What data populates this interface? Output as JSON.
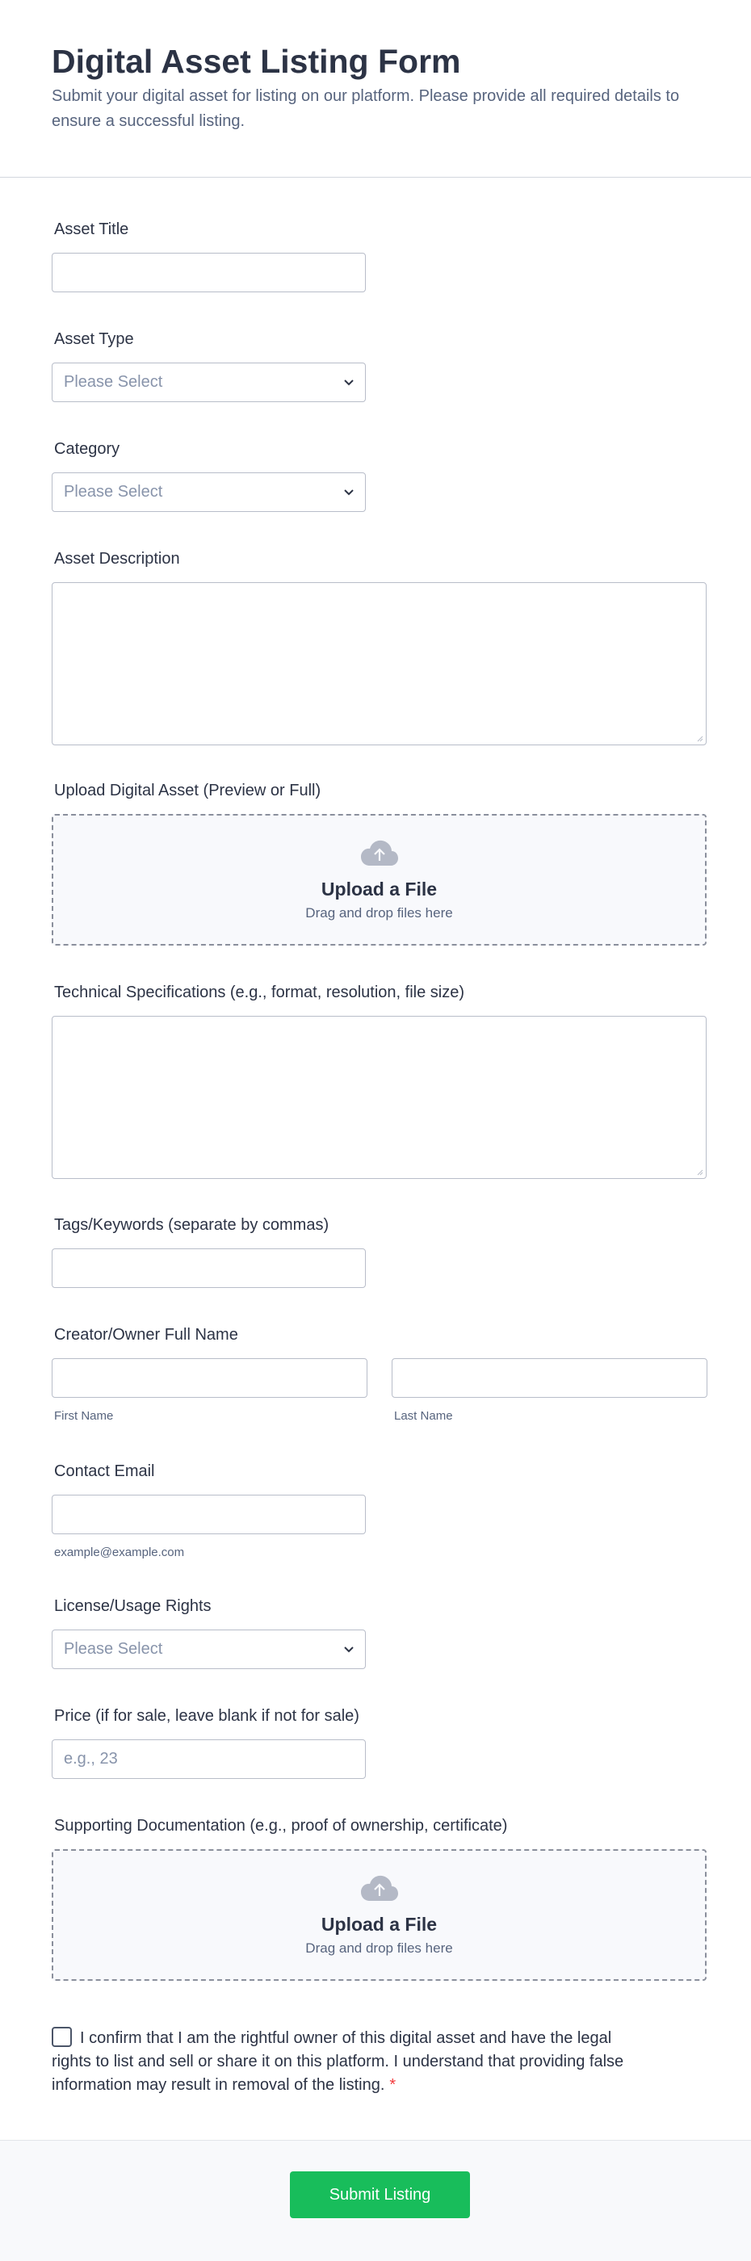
{
  "header": {
    "title": "Digital Asset Listing Form",
    "subtitle": "Submit your digital asset for listing on our platform. Please provide all required details to ensure a successful listing."
  },
  "fields": {
    "asset_title": {
      "label": "Asset Title",
      "value": ""
    },
    "asset_type": {
      "label": "Asset Type",
      "selected": "Please Select"
    },
    "category": {
      "label": "Category",
      "selected": "Please Select"
    },
    "asset_description": {
      "label": "Asset Description",
      "value": ""
    },
    "upload_asset": {
      "label": "Upload Digital Asset (Preview or Full)",
      "title": "Upload a File",
      "subtitle": "Drag and drop files here"
    },
    "tech_specs": {
      "label": "Technical Specifications (e.g., format, resolution, file size)",
      "value": ""
    },
    "tags": {
      "label": "Tags/Keywords (separate by commas)",
      "value": ""
    },
    "creator_name": {
      "label": "Creator/Owner Full Name",
      "first_sublabel": "First Name",
      "last_sublabel": "Last Name"
    },
    "contact_email": {
      "label": "Contact Email",
      "sublabel": "example@example.com"
    },
    "license": {
      "label": "License/Usage Rights",
      "selected": "Please Select"
    },
    "price": {
      "label": "Price (if for sale, leave blank if not for sale)",
      "placeholder": "e.g., 23"
    },
    "supporting_docs": {
      "label": "Supporting Documentation (e.g., proof of ownership, certificate)",
      "title": "Upload a File",
      "subtitle": "Drag and drop files here"
    }
  },
  "consent": {
    "text": "I confirm that I am the rightful owner of this digital asset and have the legal rights to list and sell or share it on this platform. I understand that providing false information may result in removal of the listing.",
    "required_mark": "*",
    "checked": false
  },
  "footer": {
    "submit_label": "Submit Listing",
    "submit_color": "#18bd5b"
  }
}
